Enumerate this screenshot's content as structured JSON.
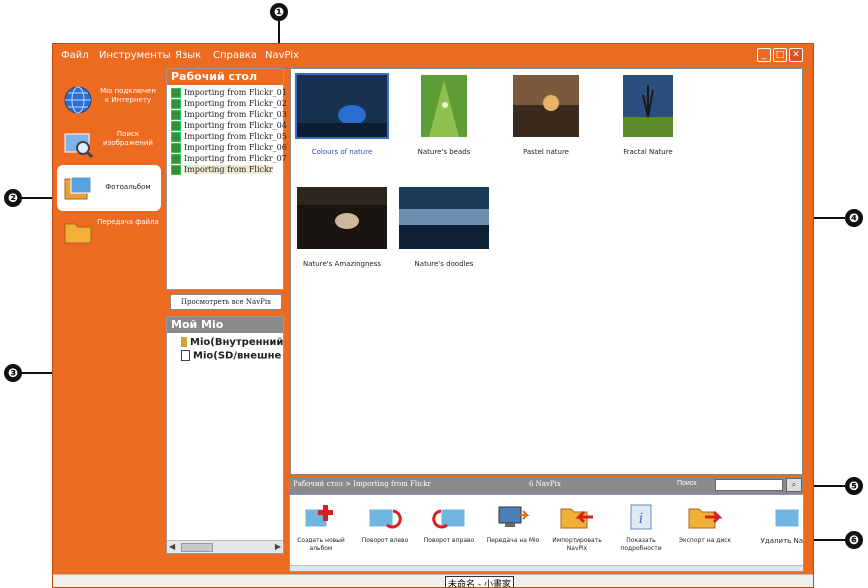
{
  "callouts": [
    "❶",
    "❷",
    "❸",
    "❹",
    "❺",
    "❻"
  ],
  "menu": [
    "Файл",
    "Инструменты",
    "Язык",
    "Справка",
    "NavPix"
  ],
  "window_buttons": [
    "_",
    "□",
    "✕"
  ],
  "nav": [
    {
      "label": "Mio подключен к Интернету",
      "icon": "globe-icon"
    },
    {
      "label": "Поиск изображений",
      "icon": "image-search-icon"
    },
    {
      "label": "Фотоальбом",
      "icon": "photo-album-icon"
    },
    {
      "label": "Передача файла",
      "icon": "file-transfer-icon"
    }
  ],
  "desktop_panel": {
    "title": "Рабочий стол",
    "items": [
      "Importing from Flickr_01",
      "Importing from Flickr_02",
      "Importing from Flickr_03",
      "Importing from Flickr_04",
      "Importing from Flickr_05",
      "Importing from Flickr_06",
      "Importing from Flickr_07",
      "Importing from Flickr"
    ]
  },
  "view_all_button": "Просмотреть все NavPix",
  "device_panel": {
    "title": "Мой Mio",
    "items": [
      "Mio(Внутренний",
      "Mio(SD/внешне"
    ]
  },
  "photos": [
    {
      "caption": "Colours of nature",
      "selected": true
    },
    {
      "caption": "Nature's beads"
    },
    {
      "caption": "Pastel nature"
    },
    {
      "caption": "Fractal Nature"
    },
    {
      "caption": "Nature's Amazingness"
    },
    {
      "caption": "Nature's doodles"
    }
  ],
  "status": {
    "breadcrumb": "Рабочий стол > Importing from Flickr",
    "count": "6 NavPix",
    "search_label": "Поиск",
    "search_value": ""
  },
  "tools": [
    {
      "label": "Создать новый альбом",
      "icon": "new-album-icon"
    },
    {
      "label": "Поворот влево",
      "icon": "rotate-left-icon"
    },
    {
      "label": "Поворот вправо",
      "icon": "rotate-right-icon"
    },
    {
      "label": "Передача на Mio",
      "icon": "transfer-to-mio-icon"
    },
    {
      "label": "Импортировать NavPix",
      "icon": "import-icon"
    },
    {
      "label": "Показать подробности",
      "icon": "info-icon"
    },
    {
      "label": "Экспорт на диск",
      "icon": "export-icon"
    },
    {
      "label": "Удалить NavPix",
      "icon": "delete-icon"
    }
  ],
  "taskbar_text": "未命名 - 小畫家"
}
